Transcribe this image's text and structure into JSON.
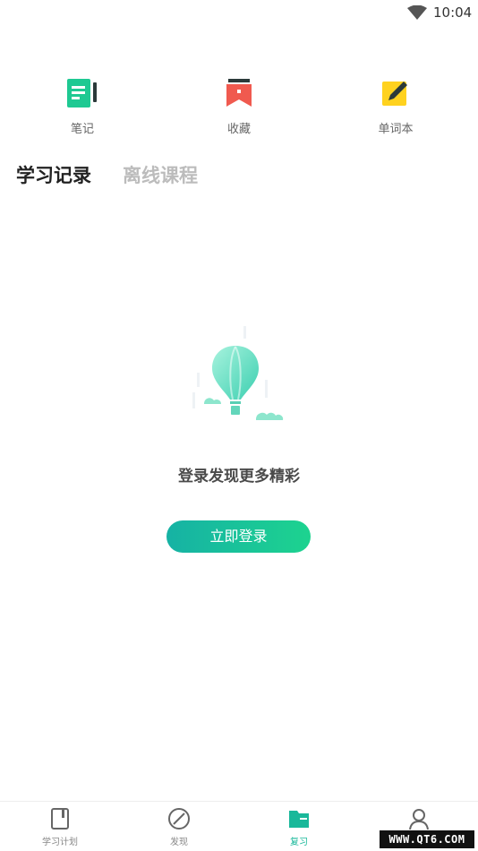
{
  "status_bar": {
    "time": "10:04"
  },
  "quick_actions": [
    {
      "label": "笔记",
      "icon": "note-icon",
      "color": "#1ec992"
    },
    {
      "label": "收藏",
      "icon": "bookmark-icon",
      "color": "#f05a4f"
    },
    {
      "label": "单词本",
      "icon": "pencil-icon",
      "color": "#ffd21f"
    }
  ],
  "tabs": [
    {
      "label": "学习记录",
      "active": true
    },
    {
      "label": "离线课程",
      "active": false
    }
  ],
  "empty_state": {
    "illustration": "hot-air-balloon-icon",
    "message": "登录发现更多精彩",
    "button_label": "立即登录"
  },
  "bottom_nav": [
    {
      "label": "学习计划",
      "icon": "plan-icon",
      "active": false
    },
    {
      "label": "发现",
      "icon": "discover-icon",
      "active": false
    },
    {
      "label": "复习",
      "icon": "review-icon",
      "active": true
    },
    {
      "label": "",
      "icon": "profile-icon",
      "active": false
    }
  ],
  "watermark": "WWW.QT6.COM",
  "colors": {
    "accent": "#19b89a",
    "tab_inactive": "#bcbcbc",
    "button_gradient_start": "#16b2a4",
    "button_gradient_end": "#1dd38f"
  }
}
